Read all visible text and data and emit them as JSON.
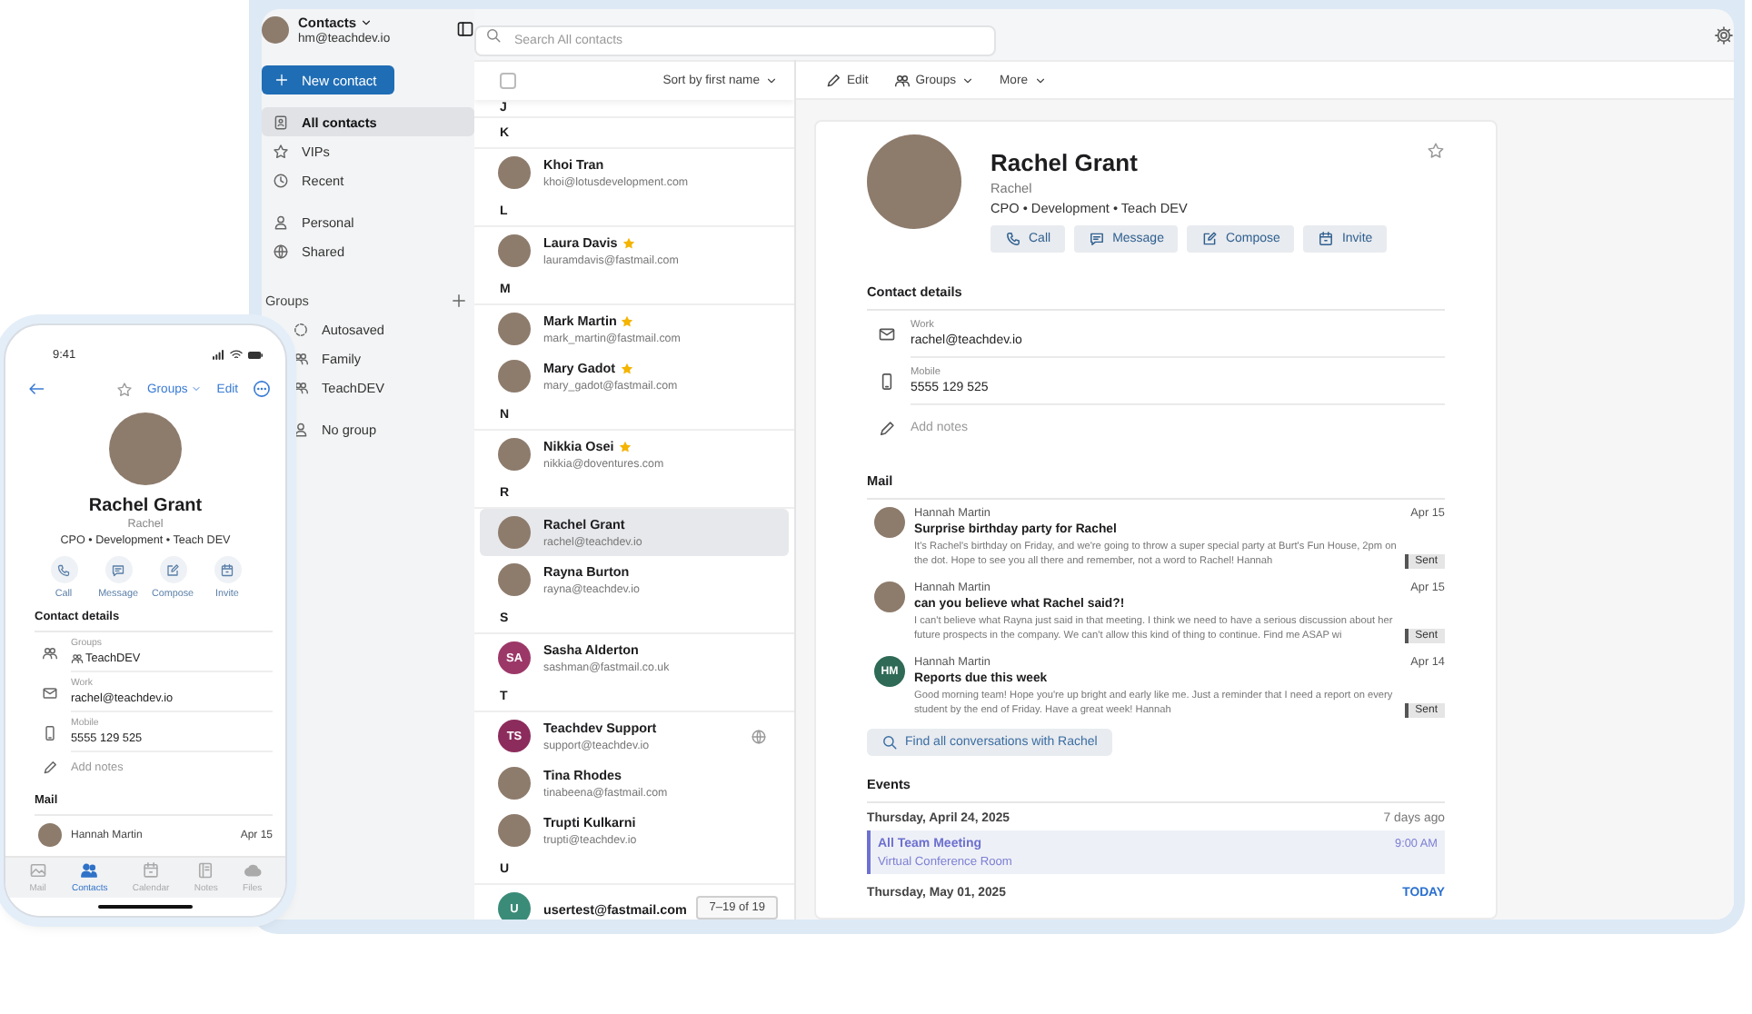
{
  "app": {
    "title": "Contacts",
    "account": "hm@teachdev.io"
  },
  "search": {
    "placeholder": "Search All contacts"
  },
  "sidebar": {
    "new_contact": "New contact",
    "sections": [
      {
        "items": [
          {
            "label": "All contacts",
            "kind": "all",
            "selected": true
          },
          {
            "label": "VIPs",
            "kind": "vip",
            "selected": false
          },
          {
            "label": "Recent",
            "kind": "recent",
            "selected": false
          }
        ]
      },
      {
        "items": [
          {
            "label": "Personal",
            "kind": "person",
            "selected": false
          },
          {
            "label": "Shared",
            "kind": "globe",
            "selected": false
          }
        ]
      },
      {
        "heading": "Groups",
        "items": [
          {
            "label": "Autosaved",
            "kind": "autosave",
            "selected": false
          },
          {
            "label": "Family",
            "kind": "group",
            "selected": false
          },
          {
            "label": "TeachDEV",
            "kind": "group",
            "selected": false
          }
        ]
      },
      {
        "items": [
          {
            "label": "No group",
            "kind": "person",
            "selected": false
          }
        ]
      }
    ]
  },
  "list": {
    "sort": "Sort by first name",
    "all_checked": false,
    "pager": "7–19 of 19",
    "sections": [
      {
        "letter": "J"
      },
      {
        "letter": "K",
        "contacts": [
          {
            "name": "Khoi Tran",
            "email": "khoi@lotusdevelopment.com",
            "kind": "photo",
            "vip": false,
            "shared": false,
            "selected": false
          }
        ]
      },
      {
        "letter": "L",
        "contacts": [
          {
            "name": "Laura Davis",
            "email": "lauramdavis@fastmail.com",
            "kind": "photo",
            "vip": true,
            "shared": false,
            "selected": false
          }
        ]
      },
      {
        "letter": "M",
        "contacts": [
          {
            "name": "Mark Martin",
            "email": "mark_martin@fastmail.com",
            "kind": "photo",
            "vip": true,
            "shared": false,
            "selected": false
          },
          {
            "name": "Mary Gadot",
            "email": "mary_gadot@fastmail.com",
            "kind": "photo",
            "vip": true,
            "shared": false,
            "selected": false
          }
        ]
      },
      {
        "letter": "N",
        "contacts": [
          {
            "name": "Nikkia Osei",
            "email": "nikkia@doventures.com",
            "kind": "photo",
            "vip": true,
            "shared": false,
            "selected": false
          }
        ]
      },
      {
        "letter": "R",
        "contacts": [
          {
            "name": "Rachel Grant",
            "email": "rachel@teachdev.io",
            "kind": "photo",
            "vip": false,
            "shared": false,
            "selected": true
          },
          {
            "name": "Rayna Burton",
            "email": "rayna@teachdev.io",
            "kind": "photo",
            "vip": false,
            "shared": false,
            "selected": false
          }
        ]
      },
      {
        "letter": "S",
        "contacts": [
          {
            "name": "Sasha Alderton",
            "email": "sashman@fastmail.co.uk",
            "kind": "initials",
            "initials": "SA",
            "color": "#9c3868",
            "vip": false,
            "shared": false,
            "selected": false
          }
        ]
      },
      {
        "letter": "T",
        "contacts": [
          {
            "name": "Teachdev Support",
            "email": "support@teachdev.io",
            "kind": "initials",
            "initials": "TS",
            "color": "#8c2c5c",
            "vip": false,
            "shared": true,
            "selected": false
          },
          {
            "name": "Tina Rhodes",
            "email": "tinabeena@fastmail.com",
            "kind": "photo",
            "vip": false,
            "shared": false,
            "selected": false
          },
          {
            "name": "Trupti Kulkarni",
            "email": "trupti@teachdev.io",
            "kind": "photo",
            "vip": false,
            "shared": false,
            "selected": false
          }
        ]
      },
      {
        "letter": "U",
        "contacts": [
          {
            "name": "usertest@fastmail.com",
            "kind": "initials",
            "initials": "U",
            "color": "#3a8c78",
            "vip": false,
            "shared": false,
            "selected": false
          }
        ]
      }
    ]
  },
  "toolbar": [
    {
      "label": "Edit",
      "kind": "edit"
    },
    {
      "label": "Groups",
      "kind": "groups"
    },
    {
      "label": "More",
      "kind": "more"
    }
  ],
  "detail": {
    "name": "Rachel Grant",
    "nickname": "Rachel",
    "title": "CPO • Development • Teach DEV",
    "vip": false,
    "actions": [
      {
        "label": "Call",
        "kind": "call"
      },
      {
        "label": "Message",
        "kind": "message"
      },
      {
        "label": "Compose",
        "kind": "compose"
      },
      {
        "label": "Invite",
        "kind": "invite"
      }
    ],
    "details_heading": "Contact details",
    "fields": [
      {
        "kind": "email",
        "label": "Work",
        "value": "rachel@teachdev.io"
      },
      {
        "kind": "phone",
        "label": "Mobile",
        "value": "5555 129 525"
      }
    ],
    "notes_placeholder": "Add notes",
    "mail_heading": "Mail",
    "mails": [
      {
        "from": "Hannah Martin",
        "date": "Apr 15",
        "subject": "Surprise birthday party for Rachel",
        "preview": "It's Rachel's birthday on Friday, and we're going to throw a super special party at Burt's Fun House, 2pm on the dot. Hope to see you all there and remember, not a word to Rachel! Hannah",
        "status": "Sent",
        "kind": "photo"
      },
      {
        "from": "Hannah Martin",
        "date": "Apr 15",
        "subject": "can you believe what Rachel said?!",
        "preview": "I can't believe what Rayna just said in that meeting. I think we need to have a serious discussion about her future prospects in the company. We can't allow this kind of thing to continue. Find me ASAP wi",
        "status": "Sent",
        "kind": "photo"
      },
      {
        "from": "Hannah Martin",
        "date": "Apr 14",
        "subject": "Reports due this week",
        "preview": "Good morning team! Hope you're up bright and early like me. Just a reminder that I need a report on every student by the end of Friday. Have a great week! Hannah",
        "status": "Sent",
        "kind": "initials",
        "initials": "HM",
        "color": "#2e6a55"
      }
    ],
    "find_all": "Find all conversations with Rachel",
    "events_heading": "Events",
    "days": [
      {
        "date": "Thursday, April 24, 2025",
        "relative": "7 days ago",
        "today": false,
        "events": [
          {
            "title": "All Team Meeting",
            "location": "Virtual Conference Room",
            "time": "9:00 AM"
          }
        ]
      },
      {
        "date": "Thursday, May 01, 2025",
        "relative": "TODAY",
        "today": true
      }
    ]
  },
  "phone": {
    "time": "9:41",
    "vip": false,
    "groups": "Groups",
    "edit": "Edit",
    "name": "Rachel Grant",
    "nickname": "Rachel",
    "title": "CPO • Development • Teach DEV",
    "actions": [
      {
        "label": "Call",
        "kind": "call"
      },
      {
        "label": "Message",
        "kind": "message"
      },
      {
        "label": "Compose",
        "kind": "compose"
      },
      {
        "label": "Invite",
        "kind": "invite"
      }
    ],
    "details_heading": "Contact details",
    "fields": [
      {
        "kind": "groups",
        "label": "Groups",
        "value": "TeachDEV"
      },
      {
        "kind": "email",
        "label": "Work",
        "value": "rachel@teachdev.io"
      },
      {
        "kind": "phone",
        "label": "Mobile",
        "value": "5555 129 525"
      }
    ],
    "notes_placeholder": "Add notes",
    "mail_heading": "Mail",
    "mail": {
      "from": "Hannah Martin",
      "date": "Apr 15"
    },
    "tabs": [
      {
        "label": "Mail",
        "kind": "mail",
        "selected": false
      },
      {
        "label": "Contacts",
        "kind": "contacts",
        "selected": true
      },
      {
        "label": "Calendar",
        "kind": "calendar",
        "selected": false
      },
      {
        "label": "Notes",
        "kind": "notes",
        "selected": false
      },
      {
        "label": "Files",
        "kind": "files",
        "selected": false
      }
    ]
  }
}
